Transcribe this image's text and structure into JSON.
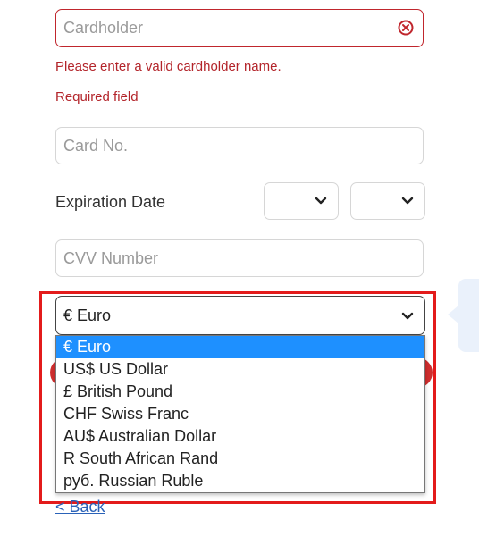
{
  "form": {
    "cardholder": {
      "placeholder": "Cardholder",
      "value": ""
    },
    "cardholder_error": "Please enter a valid cardholder name.",
    "required_error": "Required field",
    "card_no": {
      "placeholder": "Card No.",
      "value": ""
    },
    "expiration_label": "Expiration Date",
    "expiration_month": {
      "value": ""
    },
    "expiration_year": {
      "value": ""
    },
    "cvv": {
      "placeholder": "CVV Number",
      "value": ""
    },
    "currency": {
      "selected": "€ Euro",
      "options": [
        "€ Euro",
        "US$ US Dollar",
        "£ British Pound",
        "CHF Swiss Franc",
        "AU$ Australian Dollar",
        "R South African Rand",
        "руб. Russian Ruble"
      ],
      "highlighted_index": 0
    },
    "back_label": "< Back"
  },
  "colors": {
    "error": "#b3242a",
    "highlight_border": "#e31b1b",
    "option_selected_bg": "#1e90ff",
    "link": "#2a62b8"
  },
  "icons": {
    "clear": "clear-circle-x-icon",
    "chevron": "chevron-down-icon"
  }
}
